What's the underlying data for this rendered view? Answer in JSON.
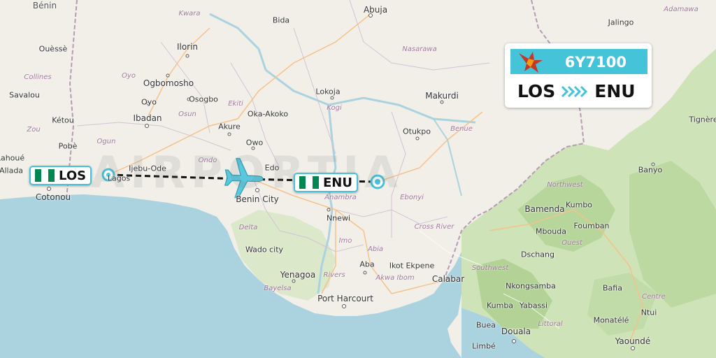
{
  "flight": {
    "number": "6Y7100",
    "origin_code": "LOS",
    "destination_code": "ENU",
    "accent_color": "#45c3d8",
    "airline_logo_icon": "star-bird-logo-icon"
  },
  "airports": {
    "origin": {
      "code": "LOS",
      "flag": "nigeria-flag-icon"
    },
    "destination": {
      "code": "ENU",
      "flag": "nigeria-flag-icon"
    }
  },
  "watermark": "AIRPORTIA",
  "map": {
    "countries": [
      "Bénin"
    ],
    "cities": [
      "Abuja",
      "Bida",
      "Jalingo",
      "Ouèssè",
      "Ilorin",
      "Ogbomosho",
      "Osogbo",
      "Oyo",
      "Ibadan",
      "Savalou",
      "Kétou",
      "Oka-Akoko",
      "Akure",
      "Lokoja",
      "Makurdi",
      "Pobè",
      "Otukpo",
      "Owo",
      "Ijebu-Ode",
      "Allada",
      "Cotonou",
      "Benin City",
      "Banyo",
      "Tignère",
      "Bamenda",
      "Kumbo",
      "Foumban",
      "Mbouda",
      "Nnewi",
      "Dschang",
      "Wado city",
      "Yenagoa",
      "Aba",
      "Ikot Ekpene",
      "Calabar",
      "Nkongsamba",
      "Bafia",
      "Port Harcourt",
      "Kumba",
      "Yabassi",
      "Ntui",
      "Buea",
      "Monatélé",
      "Douala",
      "Yaoundé",
      "Limbé",
      "Lagos",
      "Edo",
      "Lahoué"
    ],
    "regions": [
      "Kwara",
      "Adamawa",
      "Nasarawa",
      "Collines",
      "Oyo",
      "Osun",
      "Ekiti",
      "Kogi",
      "Benue",
      "Zou",
      "Ogun",
      "Ondo",
      "Northwest",
      "Anambra",
      "Ebonyi",
      "Delta",
      "Imo",
      "Cross River",
      "Ouest",
      "Abia",
      "Southwest",
      "Rivers",
      "Bayelsa",
      "Akwa Ibom",
      "Littoral",
      "Centre"
    ]
  }
}
